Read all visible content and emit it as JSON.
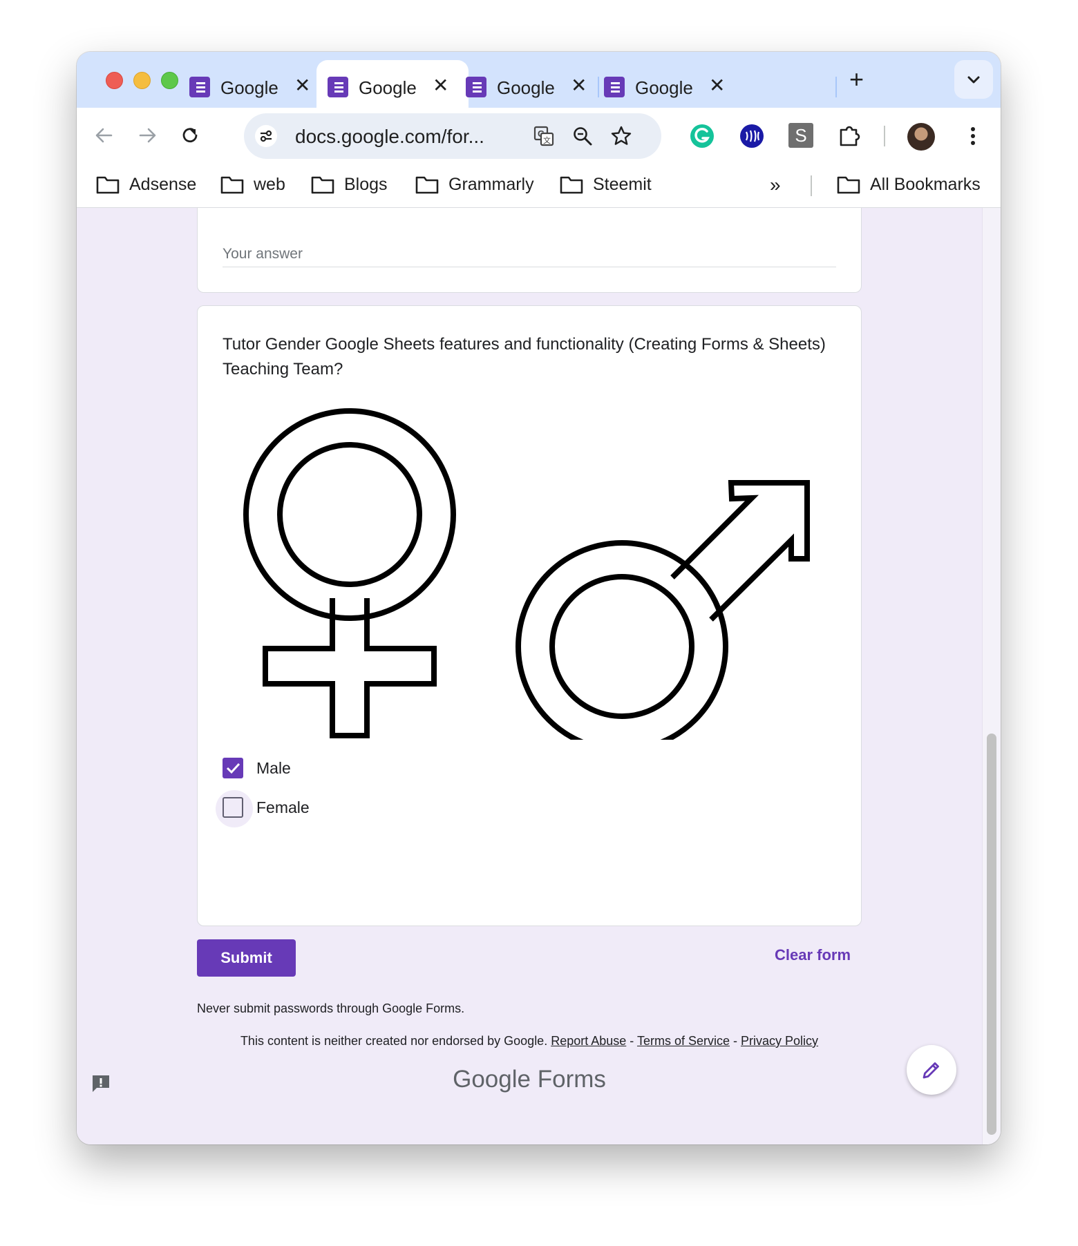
{
  "browser": {
    "tabs": [
      {
        "title": "Google"
      },
      {
        "title": "Google"
      },
      {
        "title": "Google"
      },
      {
        "title": "Google"
      }
    ],
    "new_tab": "+",
    "url": "docs.google.com/for...",
    "bookmarks": [
      "Adsense",
      "web",
      "Blogs",
      "Grammarly",
      "Steemit"
    ],
    "bookmarks_more": "»",
    "all_bookmarks": "All Bookmarks",
    "extension_s": "S"
  },
  "form": {
    "previous_answer_placeholder": "Your answer",
    "question": "Tutor Gender Google Sheets features and functionality (Creating Forms & Sheets) Teaching Team?",
    "options": [
      {
        "label": "Male",
        "checked": true
      },
      {
        "label": "Female",
        "checked": false
      }
    ],
    "submit": "Submit",
    "clear": "Clear form",
    "never_submit": "Never submit passwords through Google Forms.",
    "disclaimer_text": "This content is neither created nor endorsed by Google.",
    "links": {
      "report_abuse": "Report Abuse",
      "sep1": " - ",
      "terms": "Terms of Service",
      "sep2": " - ",
      "privacy": "Privacy Policy"
    },
    "logo_google": "Google",
    "logo_forms": "Forms"
  },
  "colors": {
    "accent": "#673ab7",
    "background": "#f0ebf8",
    "tabstrip": "#d3e3fd"
  }
}
